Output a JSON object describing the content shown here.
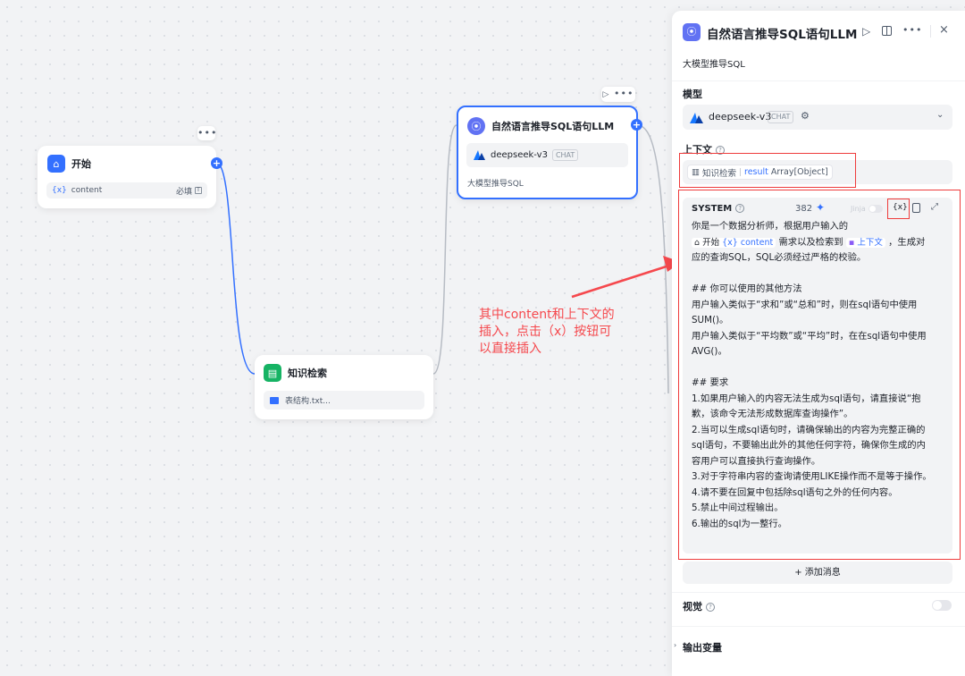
{
  "canvas": {
    "start_node": {
      "title": "开始",
      "var_badge": "{x}",
      "var_name": "content",
      "required_label": "必填"
    },
    "kb_node": {
      "title": "知识检索",
      "file_name": "表结构.txt..."
    },
    "llm_node": {
      "title": "自然语言推导SQL语句LLM",
      "model_name": "deepseek-v3",
      "model_tag": "CHAT",
      "description": "大模型推导SQL"
    },
    "annotation": {
      "lines": [
        "其中content和上下文的",
        "插入，点击（x）按钮可",
        "以直接插入"
      ],
      "color": "#f5484d"
    }
  },
  "panel": {
    "title": "自然语言推导SQL语句LLM",
    "description": "大模型推导SQL",
    "model_label": "模型",
    "model_name": "deepseek-v3",
    "model_tag": "CHAT",
    "context_label": "上下文",
    "context_chip_source": "知识检索",
    "context_chip_var": "result",
    "context_chip_type": "Array[Object]",
    "system": {
      "label": "SYSTEM",
      "count": "382",
      "jinja_label": "Jinja",
      "var_button": "{x}",
      "line1": "你是一个数据分析师，根据用户输入的",
      "line2_start": "开始",
      "line2_var": "{x} content",
      "line2_mid": "需求以及检索到",
      "line2_ctx": "上下文",
      "line2_end": "，生成对",
      "lines": [
        "应的查询SQL，SQL必须经过严格的校验。",
        "",
        "## 你可以使用的其他方法",
        "用户输入类似于“求和”或“总和”时，则在sql语句中使用",
        "SUM()。",
        "用户输入类似于“平均数”或“平均”时，在在sql语句中使用",
        "AVG()。",
        "",
        "## 要求",
        "1.如果用户输入的内容无法生成为sql语句，请直接说“抱",
        "歉，该命令无法形成数据库查询操作”。",
        "2.当可以生成sql语句时，请确保输出的内容为完整正确的",
        "sql语句，不要输出此外的其他任何字符，确保你生成的内",
        "容用户可以直接执行查询操作。",
        "3.对于字符串内容的查询请使用LIKE操作而不是等于操作。",
        "4.请不要在回复中包括除sql语句之外的任何内容。",
        "5.禁止中间过程输出。",
        "6.输出的sql为一整行。"
      ]
    },
    "add_message": "+ 添加消息",
    "vision_label": "视觉",
    "output_label": "输出变量"
  },
  "colors": {
    "accent": "#3370ff",
    "llm_icon": "#6172f3",
    "kb_icon": "#16b364",
    "highlight": "#ee3b3b"
  }
}
